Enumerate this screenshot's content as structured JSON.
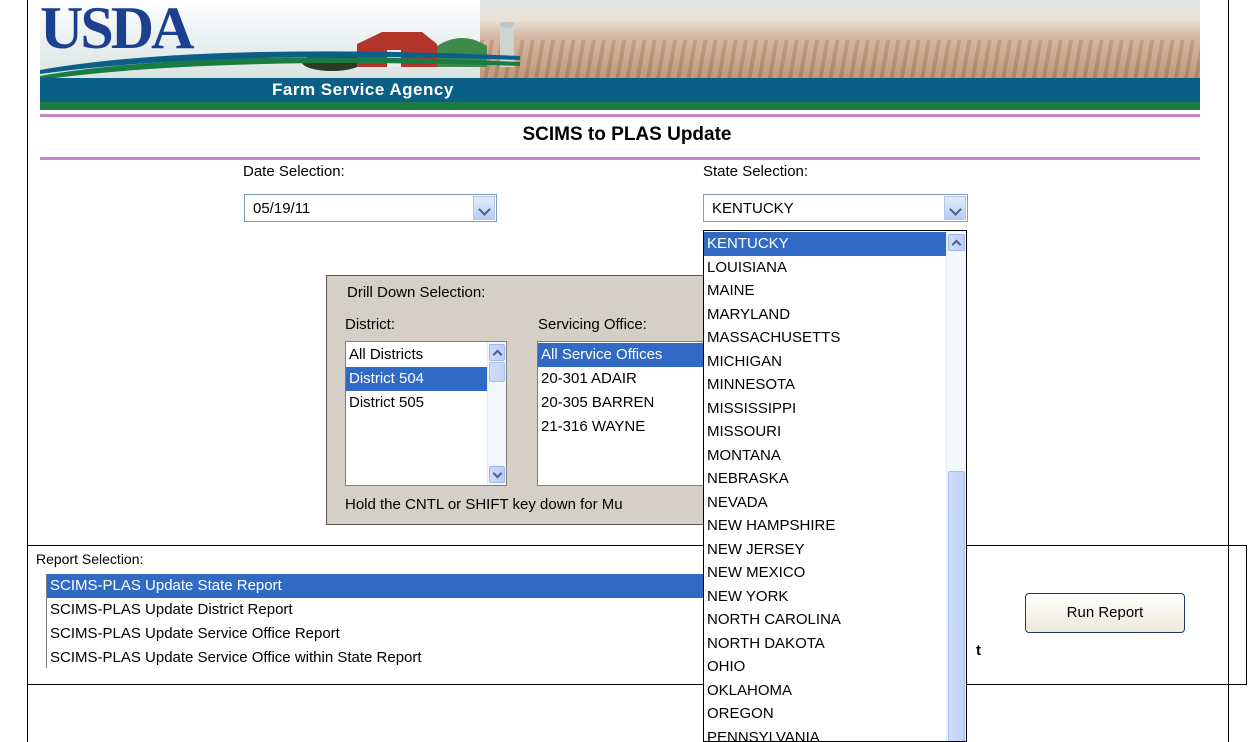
{
  "banner": {
    "logo_text": "USDA",
    "agency": "Farm Service Agency"
  },
  "page_title": "SCIMS to PLAS Update",
  "date_selection": {
    "label": "Date Selection:",
    "value": "05/19/11"
  },
  "state_selection": {
    "label": "State Selection:",
    "value": "KENTUCKY",
    "options": [
      "KENTUCKY",
      "LOUISIANA",
      "MAINE",
      "MARYLAND",
      "MASSACHUSETTS",
      "MICHIGAN",
      "MINNESOTA",
      "MISSISSIPPI",
      "MISSOURI",
      "MONTANA",
      "NEBRASKA",
      "NEVADA",
      "NEW HAMPSHIRE",
      "NEW JERSEY",
      "NEW MEXICO",
      "NEW YORK",
      "NORTH CAROLINA",
      "NORTH DAKOTA",
      "OHIO",
      "OKLAHOMA",
      "OREGON",
      "PENNSYLVANIA"
    ],
    "selected_index": 0
  },
  "drill_down": {
    "title": "Drill Down Selection:",
    "district_label": "District:",
    "districts": [
      "All Districts",
      "District 504",
      "District 505"
    ],
    "district_selected": 1,
    "office_label": "Servicing Office:",
    "offices": [
      "All Service Offices",
      "20-301  ADAIR",
      "20-305  BARREN",
      "21-316  WAYNE"
    ],
    "office_selected": 0,
    "hint": "Hold the CNTL or SHIFT key down for Mu"
  },
  "report_selection": {
    "label": "Report Selection:",
    "reports": [
      "SCIMS-PLAS Update State Report",
      "SCIMS-PLAS Update District Report",
      "SCIMS-PLAS Update Service Office Report",
      "SCIMS-PLAS Update Service Office within State Report"
    ],
    "selected": 0,
    "trailing_char": "t"
  },
  "run_report_label": "Run Report",
  "colors": {
    "select_highlight": "#316ac5",
    "rule": "#c486c6",
    "usda_blue": "#1d3f8f",
    "agency_bar": "#0a5f86"
  }
}
